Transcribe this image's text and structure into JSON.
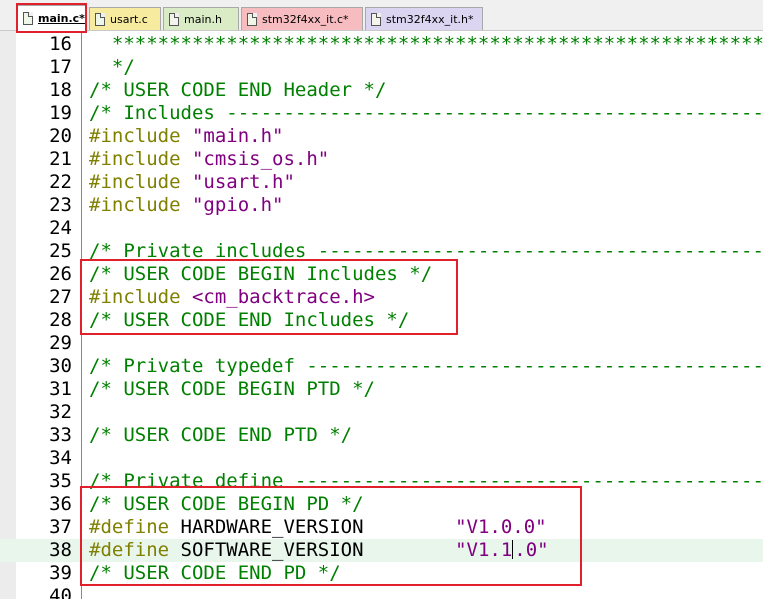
{
  "tabs": [
    {
      "label": "main.c*",
      "icon": "c-file-icon",
      "active": true,
      "bg": "#ffffff"
    },
    {
      "label": "usart.c",
      "icon": "c-file-icon",
      "active": false,
      "bg": "#f6eb9f"
    },
    {
      "label": "main.h",
      "icon": "h-file-icon",
      "active": false,
      "bg": "#d9ecc6"
    },
    {
      "label": "stm32f4xx_it.c*",
      "icon": "c-file-icon",
      "active": false,
      "bg": "#f7bcc0"
    },
    {
      "label": "stm32f4xx_it.h*",
      "icon": "h-file-icon",
      "active": false,
      "bg": "#dcd5f2"
    }
  ],
  "editor": {
    "current_line": 38,
    "lines": [
      {
        "n": "16",
        "segs": [
          {
            "c": "cmt",
            "t": "  *********************************************************"
          }
        ]
      },
      {
        "n": "17",
        "segs": [
          {
            "c": "cmt",
            "t": "  */"
          }
        ]
      },
      {
        "n": "18",
        "segs": [
          {
            "c": "cmt",
            "t": "/* USER CODE END Header */"
          }
        ]
      },
      {
        "n": "19",
        "segs": [
          {
            "c": "cmt",
            "t": "/* Includes ----------------------------------------------------"
          }
        ]
      },
      {
        "n": "20",
        "segs": [
          {
            "c": "pre",
            "t": "#include "
          },
          {
            "c": "str",
            "t": "\"main.h\""
          }
        ]
      },
      {
        "n": "21",
        "segs": [
          {
            "c": "pre",
            "t": "#include "
          },
          {
            "c": "str",
            "t": "\"cmsis_os.h\""
          }
        ]
      },
      {
        "n": "22",
        "segs": [
          {
            "c": "pre",
            "t": "#include "
          },
          {
            "c": "str",
            "t": "\"usart.h\""
          }
        ]
      },
      {
        "n": "23",
        "segs": [
          {
            "c": "pre",
            "t": "#include "
          },
          {
            "c": "str",
            "t": "\"gpio.h\""
          }
        ]
      },
      {
        "n": "24",
        "segs": []
      },
      {
        "n": "25",
        "segs": [
          {
            "c": "cmt",
            "t": "/* Private includes --------------------------------------------"
          }
        ]
      },
      {
        "n": "26",
        "segs": [
          {
            "c": "cmt",
            "t": "/* USER CODE BEGIN Includes */"
          }
        ]
      },
      {
        "n": "27",
        "segs": [
          {
            "c": "pre",
            "t": "#include "
          },
          {
            "c": "str",
            "t": "<cm_backtrace.h>"
          }
        ]
      },
      {
        "n": "28",
        "segs": [
          {
            "c": "cmt",
            "t": "/* USER CODE END Includes */"
          }
        ]
      },
      {
        "n": "29",
        "segs": []
      },
      {
        "n": "30",
        "segs": [
          {
            "c": "cmt",
            "t": "/* Private typedef ---------------------------------------------"
          }
        ]
      },
      {
        "n": "31",
        "segs": [
          {
            "c": "cmt",
            "t": "/* USER CODE BEGIN PTD */"
          }
        ]
      },
      {
        "n": "32",
        "segs": []
      },
      {
        "n": "33",
        "segs": [
          {
            "c": "cmt",
            "t": "/* USER CODE END PTD */"
          }
        ]
      },
      {
        "n": "34",
        "segs": []
      },
      {
        "n": "35",
        "segs": [
          {
            "c": "cmt",
            "t": "/* Private define ----------------------------------------------"
          }
        ]
      },
      {
        "n": "36",
        "segs": [
          {
            "c": "cmt",
            "t": "/* USER CODE BEGIN PD */"
          }
        ]
      },
      {
        "n": "37",
        "segs": [
          {
            "c": "pre",
            "t": "#define "
          },
          {
            "c": "txt",
            "t": "HARDWARE_VERSION        "
          },
          {
            "c": "str",
            "t": "\"V1.0.0\""
          }
        ]
      },
      {
        "n": "38",
        "segs": [
          {
            "c": "pre",
            "t": "#define "
          },
          {
            "c": "txt",
            "t": "SOFTWARE_VERSION        "
          },
          {
            "c": "str",
            "t": "\"V1.1"
          },
          {
            "c": "caret",
            "t": ""
          },
          {
            "c": "str",
            "t": ".0\""
          }
        ]
      },
      {
        "n": "39",
        "segs": [
          {
            "c": "cmt",
            "t": "/* USER CODE END PD */"
          }
        ]
      },
      {
        "n": "40",
        "segs": []
      }
    ]
  },
  "colors": {
    "comment": "#008000",
    "preprocessor": "#808000",
    "string": "#800080",
    "highlight_box": "#e0202a",
    "current_line": "#e8f6ec"
  }
}
